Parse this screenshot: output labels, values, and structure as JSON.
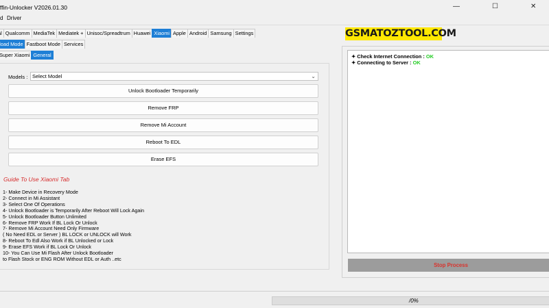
{
  "window": {
    "title": "iffin-Unlocker V2026.01.30",
    "minimize_glyph": "—",
    "maximize_glyph": "☐",
    "close_glyph": "✕"
  },
  "menu": [
    "d",
    "Driver"
  ],
  "tabs": [
    "al",
    "Qualcomm",
    "MediaTek",
    "Mediatek +",
    "Unisoc/Spreadtrum",
    "Huawei",
    "Xiaomi",
    "Apple",
    "Android",
    "Samsung",
    "Settings"
  ],
  "active_tab": "Xiaomi",
  "mode_tabs": [
    "eload Mode",
    "Fastboot Mode",
    "Services"
  ],
  "active_mode_tab": "eload Mode",
  "section_tabs": [
    "Super Xiaomi",
    "General"
  ],
  "active_section_tab": "General",
  "logo": "GSMATOZTOOL.COM",
  "models": {
    "label": "Models :",
    "value": "Select Model"
  },
  "buttons": [
    "Unlock Bootloader Temporarily",
    "Remove FRP",
    "Remove Mi Account",
    "Reboot To EDL",
    "Erase EFS"
  ],
  "guide": {
    "title": "Guide To Use Xiaomi Tab",
    "lines": [
      "1- Make Device in Recovery Mode",
      "2- Connect in Mi Assistant",
      "3- Select One Of Operations",
      "4- Unlock Bootloader is Temporarily After Reboot Will Lock Again",
      "5- Unlock Bootloader Button Unlimited",
      "6- Remove FRP Work If BL Lock Or Unlock",
      "7- Remove Mi Account Need Only Firmware",
      "( No Need EDL or Server ) BL LOCK or UNLOCK will Work",
      "8- Reboot To Edl Also Work if BL Unlocked or Lock",
      "9- Erase EFS Work if BL Lock Or Unlock",
      "10- You Can Use Mi Flash After Unlock Bootloader",
      "to Flash Stock or ENG ROM Without EDL or Auth ..etc"
    ]
  },
  "log": [
    {
      "label": "Check Internet Connection : ",
      "status": "OK"
    },
    {
      "label": "Connecting to Server : ",
      "status": "OK"
    }
  ],
  "stop_button": "Stop Process",
  "progress": {
    "value": 0,
    "label": "/0%"
  },
  "colors": {
    "accent": "#1e7fd6",
    "ok": "#22cc22",
    "stop_text": "#d9332d",
    "guide_title": "#d62b2b",
    "logo_bg": "#ffe800"
  }
}
